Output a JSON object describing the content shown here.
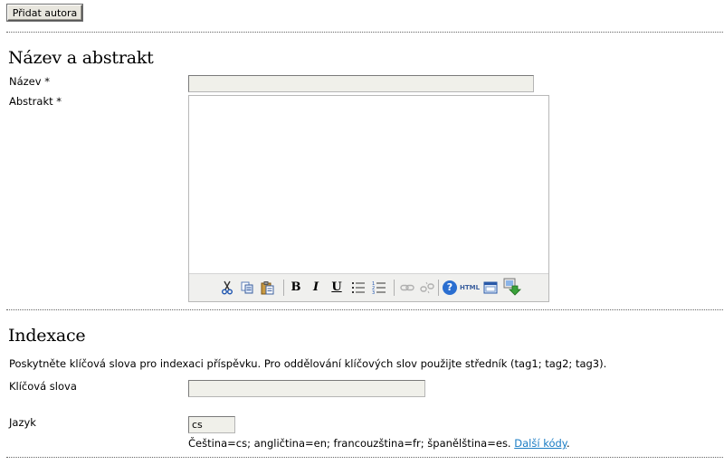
{
  "buttons": {
    "add_author": "Přidat autora"
  },
  "title_abstract": {
    "heading": "Název a abstrakt",
    "title_label": "Název *",
    "title_value": "",
    "abstract_label": "Abstrakt *",
    "abstract_value": "",
    "editor_toolbar": [
      "cut-icon",
      "copy-icon",
      "paste-icon",
      "bold-icon",
      "italic-icon",
      "underline-icon",
      "bullet-list-icon",
      "numbered-list-icon",
      "link-icon",
      "unlink-icon",
      "help-icon",
      "html-source-icon",
      "fullscreen-icon",
      "insert-image-icon"
    ],
    "bold_glyph": "B",
    "italic_glyph": "I",
    "underline_glyph": "U",
    "help_glyph": "?",
    "html_glyph": "HTML"
  },
  "indexing": {
    "heading": "Indexace",
    "description": "Poskytněte klíčová slova pro indexaci příspěvku. Pro oddělování klíčových slov použijte středník (tag1; tag2; tag3).",
    "keywords_label": "Klíčová slova",
    "keywords_value": "",
    "language_label": "Jazyk",
    "language_value": "cs",
    "language_hint": "Čeština=cs; angličtina=en; francouzština=fr; španělština=es.",
    "more_codes_link": "Další kódy"
  },
  "colors": {
    "link": "#1a7cc4",
    "input_bg": "#f0f0ea",
    "toolbar_bg": "#f0f0ee"
  }
}
